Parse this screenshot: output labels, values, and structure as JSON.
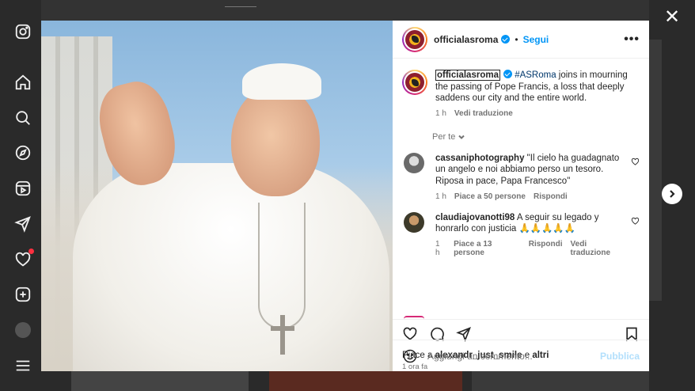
{
  "post": {
    "username": "officialasroma",
    "follow_label": "Segui",
    "more_label": "•••",
    "dot": "•",
    "caption": {
      "username": "officialasroma",
      "hashtag": "#ASRoma",
      "text": " joins in mourning the passing of Pope Francis, a loss that deeply saddens our city and the entire world.",
      "time": "1 h",
      "translate": "Vedi traduzione"
    },
    "filter_label": "Per te",
    "comments": [
      {
        "username": "cassaniphotography",
        "text": " \"Il cielo ha guadagnato un angelo e noi abbiamo perso un tesoro. Riposa in pace, Papa Francesco\"",
        "time": "1 h",
        "likes": "Piace a 50 persone",
        "reply": "Rispondi",
        "translate": ""
      },
      {
        "username": "claudiajovanotti98",
        "text": " A seguir su legado y honrarlo con justicia 🙏🙏🙏🙏🙏",
        "time": "1 h",
        "likes": "Piace a 13 persone",
        "reply": "Rispondi",
        "translate": "Vedi traduzione"
      }
    ],
    "likes_prefix": "Piace a ",
    "likes_user": "alexandr_just_smile",
    "likes_mid": " e ",
    "likes_suffix": "altri",
    "time_ago": "1 ora fa",
    "comment_placeholder": "Aggiungi un commento...",
    "publish_label": "Pubblica"
  },
  "colors": {
    "accent": "#0095f6",
    "hashtag": "#00376b",
    "notification": "#ff3040"
  }
}
